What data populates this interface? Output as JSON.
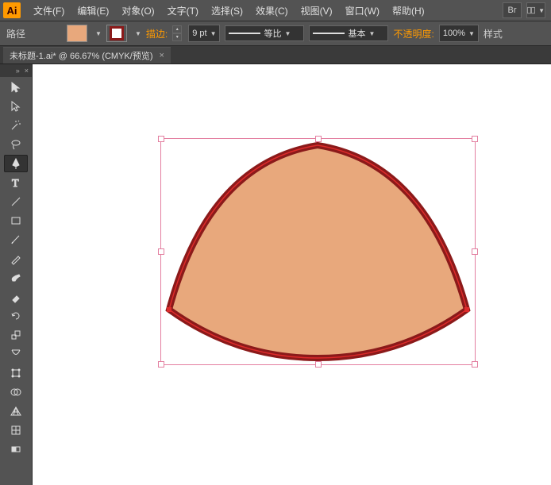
{
  "app": {
    "logo_text": "Ai"
  },
  "menu": {
    "file": "文件(F)",
    "edit": "编辑(E)",
    "object": "对象(O)",
    "type": "文字(T)",
    "select": "选择(S)",
    "effect": "效果(C)",
    "view": "视图(V)",
    "window": "窗口(W)",
    "help": "帮助(H)",
    "br_label": "Br"
  },
  "control": {
    "mode": "路径",
    "stroke_label": "描边:",
    "stroke_weight": "9 pt",
    "uniform": "等比",
    "basic": "基本",
    "opacity_label": "不透明度:",
    "opacity_value": "100%",
    "style_label": "样式"
  },
  "tab": {
    "title": "未标题-1.ai* @ 66.67% (CMYK/预览)",
    "close": "×"
  },
  "tools": {
    "panel_dots": "»",
    "panel_x": "×"
  },
  "colors": {
    "fill": "#e8a87c",
    "stroke": "#8b1a1a",
    "selection": "#e37fa0"
  }
}
